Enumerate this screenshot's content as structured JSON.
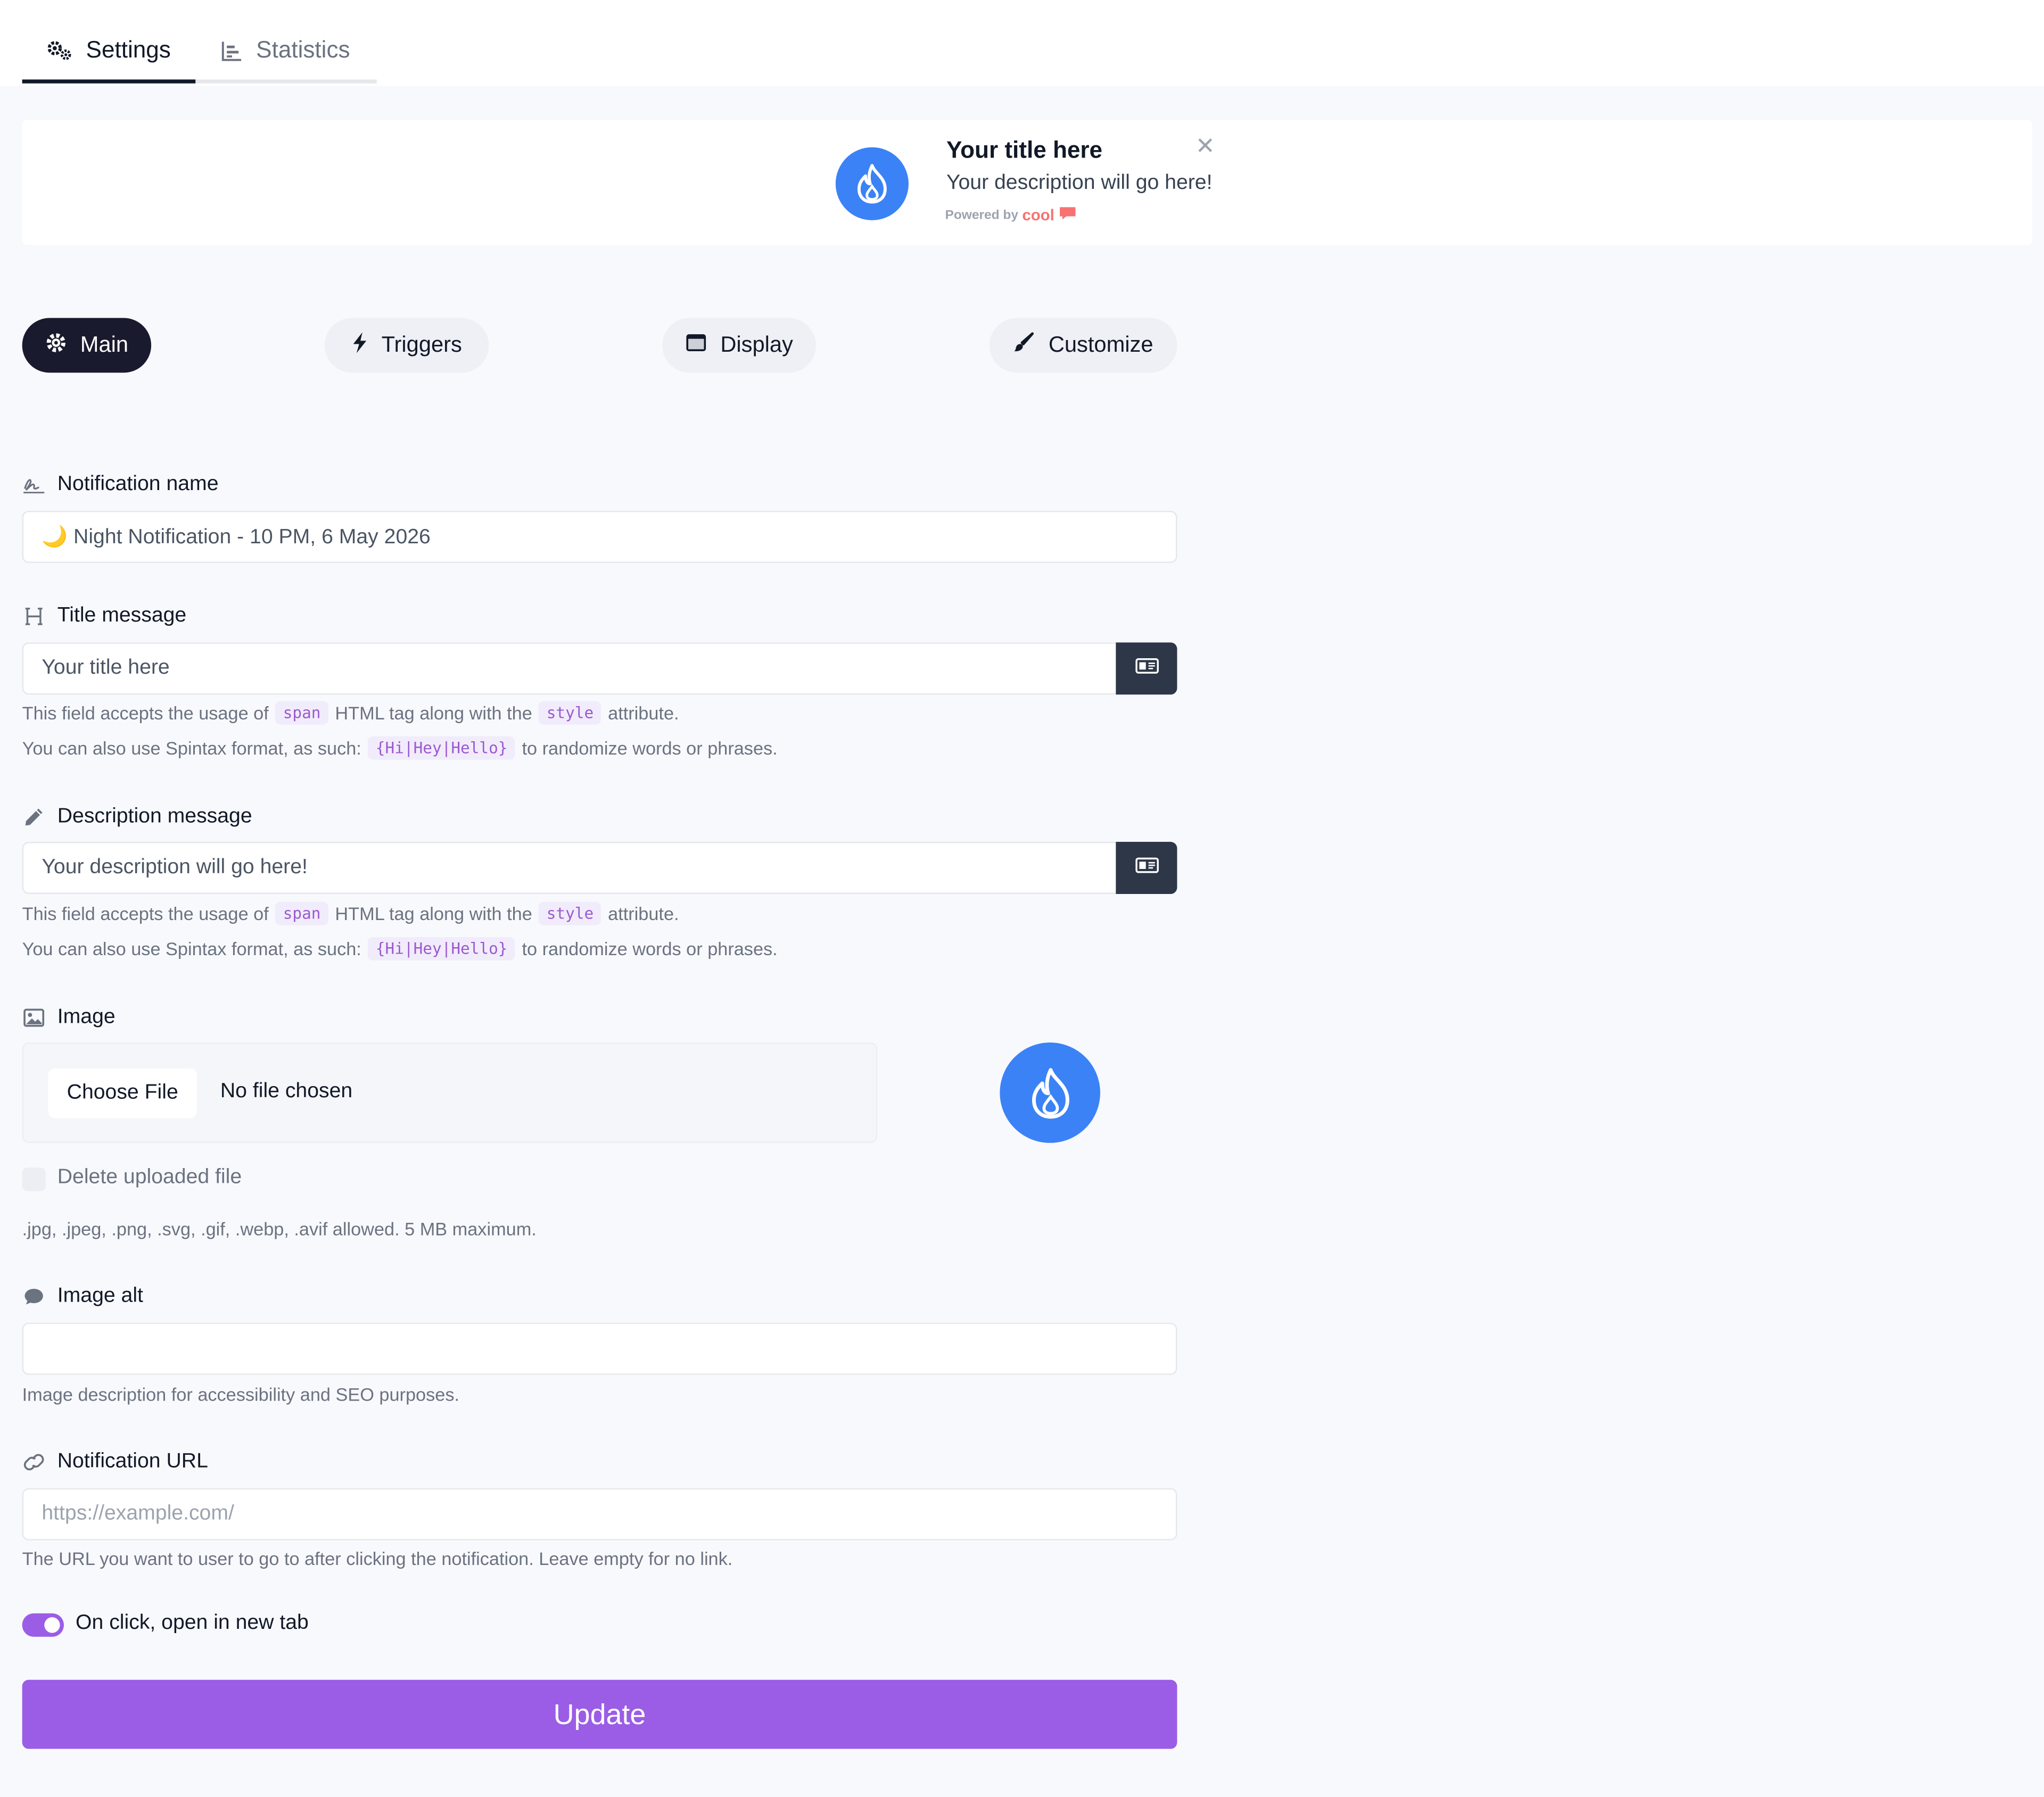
{
  "top_tabs": {
    "settings_label": "Settings",
    "statistics_label": "Statistics"
  },
  "preview": {
    "title": "Your title here",
    "description": "Your description will go here!",
    "powered_prefix": "Powered by",
    "powered_brand": "cool",
    "close_glyph": "✕"
  },
  "section_tabs": {
    "main": "Main",
    "triggers": "Triggers",
    "display": "Display",
    "customize": "Customize"
  },
  "form": {
    "notification_name": {
      "label": "Notification name",
      "value": "🌙  Night Notification - 10 PM, 6 May 2026"
    },
    "title_message": {
      "label": "Title message",
      "value": "Your title here",
      "help1_a": "This field accepts the usage of",
      "help1_code1": "span",
      "help1_b": "HTML tag along with the",
      "help1_code2": "style",
      "help1_c": "attribute.",
      "help2_a": "You can also use Spintax format, as such:",
      "help2_code": "{Hi|Hey|Hello}",
      "help2_b": "to randomize words or phrases."
    },
    "description_message": {
      "label": "Description message",
      "value": "Your description will go here!",
      "help1_a": "This field accepts the usage of",
      "help1_code1": "span",
      "help1_b": "HTML tag along with the",
      "help1_code2": "style",
      "help1_c": "attribute.",
      "help2_a": "You can also use Spintax format, as such:",
      "help2_code": "{Hi|Hey|Hello}",
      "help2_b": "to randomize words or phrases."
    },
    "image": {
      "label": "Image",
      "choose_label": "Choose File",
      "file_status": "No file chosen",
      "delete_label": "Delete uploaded file",
      "allowed": ".jpg, .jpeg, .png, .svg, .gif, .webp, .avif allowed. 5 MB maximum."
    },
    "image_alt": {
      "label": "Image alt",
      "value": "",
      "help": "Image description for accessibility and SEO purposes."
    },
    "notification_url": {
      "label": "Notification URL",
      "placeholder": "https://example.com/",
      "help": "The URL you want to user to go to after clicking the notification. Leave empty for no link."
    },
    "open_new_tab": {
      "label": "On click, open in new tab",
      "enabled": true
    },
    "update_label": "Update"
  },
  "colors": {
    "accent": "#9b5de5",
    "brand_blue": "#3b82f6",
    "dark": "#1a1a2e"
  },
  "icons": {
    "settings": "gears-icon",
    "statistics": "bar-chart-icon",
    "fire": "fire-icon",
    "main": "gear-icon",
    "triggers": "bolt-icon",
    "display": "window-icon",
    "customize": "brush-icon",
    "signature": "signature-icon",
    "heading": "heading-icon",
    "pen": "pen-icon",
    "image": "image-icon",
    "comment": "comment-icon",
    "link": "link-icon",
    "id_card": "id-card-icon"
  }
}
